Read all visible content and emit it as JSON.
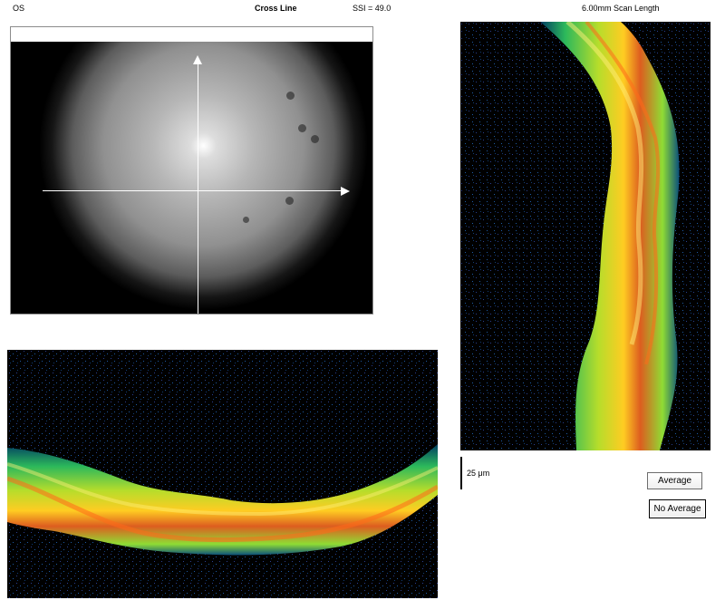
{
  "header": {
    "eye": "OS",
    "mode": "Cross Line",
    "ssi": "SSI = 49.0",
    "scan_length": "6.00mm Scan Length"
  },
  "scale": {
    "label": "25 μm"
  },
  "buttons": {
    "average_label": "Average",
    "no_average_label": "No Average"
  }
}
